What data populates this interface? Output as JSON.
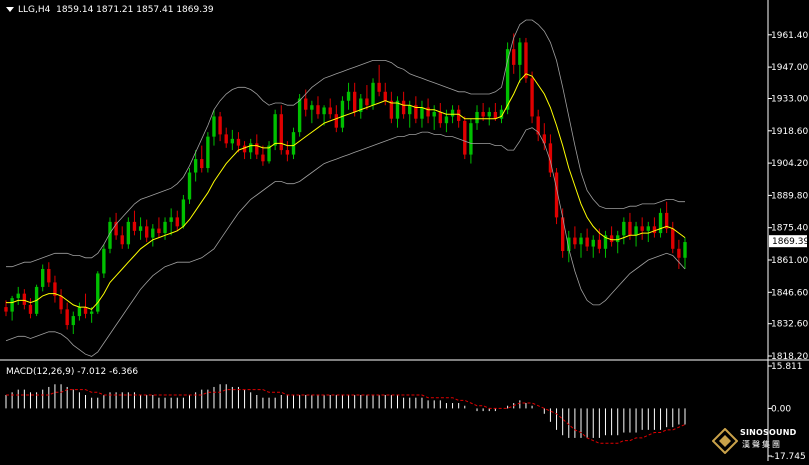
{
  "header": {
    "symbol": "LLG,H4",
    "ohlc": "1859.14 1871.21 1857.41 1869.39",
    "menu_icon": "triangle-down-icon"
  },
  "macd": {
    "label": "MACD(12,26,9) -7.012 -6.366",
    "ticks": [
      "15.811",
      "0.00",
      "-17.745"
    ]
  },
  "logo": {
    "line1": "SINOSOUND",
    "line2": "漢聲集團",
    "icon": "diamond-logo-icon"
  },
  "colors": {
    "background": "#000000",
    "up_candle": "#00c000",
    "down_candle": "#e00000",
    "ma_line": "#ffff00",
    "bollinger": "#a0a0a0",
    "signal_line": "#e00000",
    "histogram": "#ffffff"
  },
  "chart_data": [
    {
      "type": "candlestick",
      "title": "LLG,H4",
      "ylim": [
        1818.2,
        1968.0
      ],
      "y_ticks": [
        "1961.40",
        "1947.00",
        "1933.00",
        "1918.60",
        "1904.20",
        "1889.80",
        "1875.40",
        "1861.00",
        "1846.60",
        "1832.60",
        "1818.20"
      ],
      "current_price": "1869.39",
      "grid": false,
      "candles": [
        [
          1840,
          1843,
          1836,
          1838
        ],
        [
          1838,
          1845,
          1834,
          1844
        ],
        [
          1844,
          1849,
          1841,
          1846
        ],
        [
          1846,
          1848,
          1839,
          1841
        ],
        [
          1841,
          1844,
          1835,
          1837
        ],
        [
          1837,
          1850,
          1836,
          1849
        ],
        [
          1849,
          1859,
          1847,
          1857
        ],
        [
          1857,
          1860,
          1849,
          1851
        ],
        [
          1851,
          1854,
          1842,
          1845
        ],
        [
          1845,
          1848,
          1837,
          1839
        ],
        [
          1839,
          1842,
          1830,
          1832
        ],
        [
          1832,
          1838,
          1828,
          1836
        ],
        [
          1836,
          1842,
          1834,
          1840
        ],
        [
          1840,
          1846,
          1835,
          1837
        ],
        [
          1837,
          1840,
          1833,
          1838
        ],
        [
          1838,
          1856,
          1837,
          1855
        ],
        [
          1855,
          1868,
          1853,
          1866
        ],
        [
          1866,
          1880,
          1864,
          1878
        ],
        [
          1878,
          1882,
          1870,
          1872
        ],
        [
          1872,
          1876,
          1866,
          1868
        ],
        [
          1868,
          1880,
          1866,
          1878
        ],
        [
          1878,
          1883,
          1872,
          1874
        ],
        [
          1874,
          1880,
          1870,
          1876
        ],
        [
          1876,
          1879,
          1869,
          1871
        ],
        [
          1871,
          1877,
          1867,
          1875
        ],
        [
          1875,
          1880,
          1871,
          1873
        ],
        [
          1873,
          1880,
          1870,
          1878
        ],
        [
          1878,
          1884,
          1872,
          1880
        ],
        [
          1880,
          1883,
          1874,
          1876
        ],
        [
          1876,
          1890,
          1875,
          1888
        ],
        [
          1888,
          1902,
          1886,
          1900
        ],
        [
          1900,
          1910,
          1896,
          1906
        ],
        [
          1906,
          1912,
          1900,
          1902
        ],
        [
          1902,
          1918,
          1900,
          1916
        ],
        [
          1916,
          1928,
          1912,
          1925
        ],
        [
          1925,
          1927,
          1914,
          1917
        ],
        [
          1917,
          1920,
          1911,
          1913
        ],
        [
          1913,
          1919,
          1910,
          1915
        ],
        [
          1915,
          1918,
          1909,
          1912
        ],
        [
          1912,
          1914,
          1906,
          1909
        ],
        [
          1909,
          1915,
          1906,
          1913
        ],
        [
          1913,
          1917,
          1906,
          1908
        ],
        [
          1908,
          1912,
          1903,
          1905
        ],
        [
          1905,
          1914,
          1904,
          1912
        ],
        [
          1912,
          1928,
          1910,
          1926
        ],
        [
          1926,
          1930,
          1908,
          1910
        ],
        [
          1910,
          1914,
          1905,
          1908
        ],
        [
          1908,
          1920,
          1906,
          1918
        ],
        [
          1918,
          1935,
          1916,
          1933
        ],
        [
          1933,
          1937,
          1925,
          1928
        ],
        [
          1928,
          1932,
          1922,
          1930
        ],
        [
          1930,
          1934,
          1924,
          1926
        ],
        [
          1926,
          1930,
          1921,
          1929
        ],
        [
          1929,
          1933,
          1924,
          1926
        ],
        [
          1926,
          1930,
          1918,
          1920
        ],
        [
          1920,
          1934,
          1918,
          1932
        ],
        [
          1932,
          1940,
          1928,
          1936
        ],
        [
          1936,
          1940,
          1925,
          1927
        ],
        [
          1927,
          1935,
          1924,
          1933
        ],
        [
          1933,
          1939,
          1928,
          1930
        ],
        [
          1930,
          1942,
          1928,
          1940
        ],
        [
          1940,
          1948,
          1934,
          1936
        ],
        [
          1936,
          1940,
          1930,
          1932
        ],
        [
          1932,
          1936,
          1922,
          1924
        ],
        [
          1924,
          1934,
          1920,
          1932
        ],
        [
          1932,
          1936,
          1924,
          1926
        ],
        [
          1926,
          1932,
          1920,
          1930
        ],
        [
          1930,
          1934,
          1922,
          1924
        ],
        [
          1924,
          1932,
          1920,
          1929
        ],
        [
          1929,
          1933,
          1922,
          1925
        ],
        [
          1925,
          1930,
          1919,
          1927
        ],
        [
          1927,
          1931,
          1920,
          1922
        ],
        [
          1922,
          1928,
          1918,
          1925
        ],
        [
          1925,
          1930,
          1922,
          1928
        ],
        [
          1928,
          1930,
          1920,
          1923
        ],
        [
          1923,
          1925,
          1906,
          1908
        ],
        [
          1908,
          1924,
          1904,
          1922
        ],
        [
          1922,
          1930,
          1919,
          1927
        ],
        [
          1927,
          1931,
          1923,
          1925
        ],
        [
          1925,
          1929,
          1921,
          1927
        ],
        [
          1927,
          1931,
          1923,
          1924
        ],
        [
          1924,
          1930,
          1922,
          1928
        ],
        [
          1928,
          1958,
          1926,
          1955
        ],
        [
          1955,
          1962,
          1944,
          1948
        ],
        [
          1948,
          1960,
          1940,
          1958
        ],
        [
          1958,
          1960,
          1940,
          1942
        ],
        [
          1942,
          1945,
          1922,
          1925
        ],
        [
          1925,
          1928,
          1914,
          1917
        ],
        [
          1917,
          1922,
          1910,
          1913
        ],
        [
          1913,
          1917,
          1898,
          1900
        ],
        [
          1900,
          1902,
          1877,
          1880
        ],
        [
          1880,
          1884,
          1862,
          1865
        ],
        [
          1865,
          1874,
          1860,
          1871
        ],
        [
          1871,
          1876,
          1866,
          1868
        ],
        [
          1868,
          1873,
          1862,
          1871
        ],
        [
          1871,
          1875,
          1865,
          1867
        ],
        [
          1867,
          1872,
          1862,
          1870
        ],
        [
          1870,
          1875,
          1864,
          1866
        ],
        [
          1866,
          1874,
          1862,
          1872
        ],
        [
          1872,
          1876,
          1867,
          1869
        ],
        [
          1869,
          1874,
          1864,
          1872
        ],
        [
          1872,
          1880,
          1868,
          1878
        ],
        [
          1878,
          1882,
          1870,
          1872
        ],
        [
          1872,
          1878,
          1867,
          1876
        ],
        [
          1876,
          1880,
          1870,
          1874
        ],
        [
          1874,
          1878,
          1869,
          1876
        ],
        [
          1876,
          1880,
          1871,
          1873
        ],
        [
          1873,
          1884,
          1871,
          1882
        ],
        [
          1882,
          1887,
          1873,
          1875
        ],
        [
          1875,
          1878,
          1864,
          1866
        ],
        [
          1866,
          1870,
          1857,
          1862
        ],
        [
          1862,
          1871,
          1857,
          1869
        ]
      ],
      "ma": [
        1842,
        1842,
        1843,
        1843,
        1842,
        1843,
        1845,
        1846,
        1846,
        1845,
        1843,
        1841,
        1840,
        1840,
        1839,
        1842,
        1846,
        1851,
        1854,
        1857,
        1860,
        1863,
        1866,
        1868,
        1870,
        1871,
        1872,
        1873,
        1874,
        1876,
        1879,
        1883,
        1887,
        1891,
        1896,
        1900,
        1904,
        1907,
        1910,
        1911,
        1912,
        1912,
        1911,
        1911,
        1913,
        1913,
        1912,
        1912,
        1914,
        1916,
        1918,
        1920,
        1922,
        1923,
        1924,
        1925,
        1926,
        1927,
        1928,
        1929,
        1930,
        1931,
        1932,
        1931,
        1931,
        1930,
        1930,
        1929,
        1929,
        1928,
        1928,
        1927,
        1926,
        1926,
        1926,
        1924,
        1924,
        1924,
        1924,
        1924,
        1924,
        1925,
        1930,
        1935,
        1941,
        1944,
        1943,
        1939,
        1935,
        1929,
        1921,
        1912,
        1902,
        1894,
        1886,
        1880,
        1876,
        1873,
        1871,
        1870,
        1870,
        1871,
        1872,
        1872,
        1873,
        1873,
        1874,
        1875,
        1876,
        1875,
        1873,
        1871
      ],
      "bb_upper": [
        1858,
        1858,
        1859,
        1860,
        1860,
        1861,
        1862,
        1863,
        1864,
        1864,
        1864,
        1863,
        1863,
        1862,
        1862,
        1864,
        1868,
        1873,
        1877,
        1880,
        1883,
        1886,
        1888,
        1889,
        1890,
        1891,
        1892,
        1893,
        1895,
        1898,
        1903,
        1909,
        1915,
        1921,
        1928,
        1932,
        1935,
        1937,
        1938,
        1938,
        1937,
        1935,
        1932,
        1930,
        1931,
        1931,
        1930,
        1930,
        1932,
        1935,
        1938,
        1940,
        1942,
        1943,
        1944,
        1945,
        1946,
        1947,
        1948,
        1949,
        1950,
        1950,
        1950,
        1949,
        1947,
        1946,
        1944,
        1943,
        1942,
        1941,
        1940,
        1939,
        1938,
        1937,
        1936,
        1936,
        1935,
        1935,
        1935,
        1935,
        1936,
        1938,
        1950,
        1960,
        1966,
        1968,
        1968,
        1966,
        1963,
        1958,
        1950,
        1938,
        1925,
        1912,
        1900,
        1892,
        1888,
        1885,
        1884,
        1884,
        1884,
        1884,
        1885,
        1885,
        1886,
        1886,
        1886,
        1887,
        1888,
        1888,
        1887,
        1887
      ],
      "bb_lower": [
        1825,
        1826,
        1827,
        1827,
        1826,
        1827,
        1828,
        1829,
        1829,
        1828,
        1826,
        1823,
        1821,
        1819,
        1818,
        1820,
        1824,
        1828,
        1832,
        1836,
        1840,
        1844,
        1848,
        1851,
        1854,
        1856,
        1858,
        1859,
        1860,
        1860,
        1860,
        1861,
        1862,
        1864,
        1866,
        1870,
        1874,
        1878,
        1882,
        1885,
        1888,
        1890,
        1892,
        1894,
        1896,
        1896,
        1895,
        1895,
        1896,
        1898,
        1900,
        1902,
        1904,
        1905,
        1906,
        1907,
        1908,
        1909,
        1910,
        1911,
        1912,
        1913,
        1914,
        1915,
        1916,
        1916,
        1917,
        1917,
        1918,
        1918,
        1917,
        1917,
        1916,
        1916,
        1915,
        1914,
        1913,
        1913,
        1913,
        1913,
        1912,
        1912,
        1910,
        1910,
        1914,
        1919,
        1920,
        1918,
        1913,
        1905,
        1893,
        1880,
        1866,
        1856,
        1848,
        1843,
        1841,
        1841,
        1843,
        1846,
        1849,
        1852,
        1855,
        1857,
        1859,
        1861,
        1862,
        1863,
        1864,
        1863,
        1860,
        1857
      ]
    },
    {
      "type": "bar+line",
      "title": "MACD(12,26,9)",
      "ylim": [
        -17.745,
        15.811
      ],
      "histogram": [
        5,
        6,
        7,
        7,
        6,
        6,
        7,
        8,
        9,
        9,
        8,
        7,
        6,
        5,
        4,
        4,
        5,
        6,
        6,
        6,
        6,
        6,
        5,
        5,
        5,
        4,
        4,
        4,
        4,
        4,
        5,
        6,
        7,
        7,
        8,
        9,
        9,
        8,
        8,
        7,
        6,
        5,
        4,
        4,
        4,
        5,
        5,
        5,
        5,
        5,
        5,
        5,
        5,
        5,
        5,
        5,
        5,
        5,
        5,
        5,
        5,
        5,
        5,
        5,
        5,
        4,
        4,
        4,
        4,
        3,
        3,
        3,
        2,
        2,
        2,
        1,
        0,
        -1,
        -1,
        -1,
        -1,
        0,
        1,
        2,
        3,
        2,
        1,
        0,
        -2,
        -5,
        -8,
        -10,
        -11,
        -11,
        -11,
        -11,
        -11,
        -11,
        -10,
        -10,
        -10,
        -9,
        -9,
        -9,
        -8,
        -8,
        -8,
        -8,
        -7,
        -7,
        -6,
        -6
      ],
      "signal": [
        5,
        5,
        5,
        5,
        5,
        5,
        5,
        5,
        6,
        6,
        7,
        7,
        7,
        7,
        6,
        6,
        5,
        5,
        5,
        5,
        5,
        5,
        5,
        5,
        5,
        5,
        5,
        5,
        5,
        5,
        5,
        5,
        5,
        6,
        6,
        6,
        7,
        7,
        7,
        7,
        7,
        7,
        7,
        6,
        6,
        6,
        5,
        5,
        5,
        5,
        5,
        5,
        5,
        5,
        5,
        5,
        5,
        5,
        5,
        5,
        5,
        5,
        5,
        5,
        5,
        5,
        5,
        5,
        5,
        4,
        4,
        4,
        4,
        4,
        3,
        3,
        2,
        1,
        1,
        0,
        0,
        0,
        0,
        1,
        2,
        2,
        2,
        1,
        0,
        -1,
        -2,
        -4,
        -6,
        -8,
        -9,
        -11,
        -12,
        -13,
        -13,
        -13,
        -13,
        -12,
        -12,
        -11,
        -11,
        -10,
        -9,
        -9,
        -8,
        -8,
        -7,
        -6
      ]
    }
  ]
}
